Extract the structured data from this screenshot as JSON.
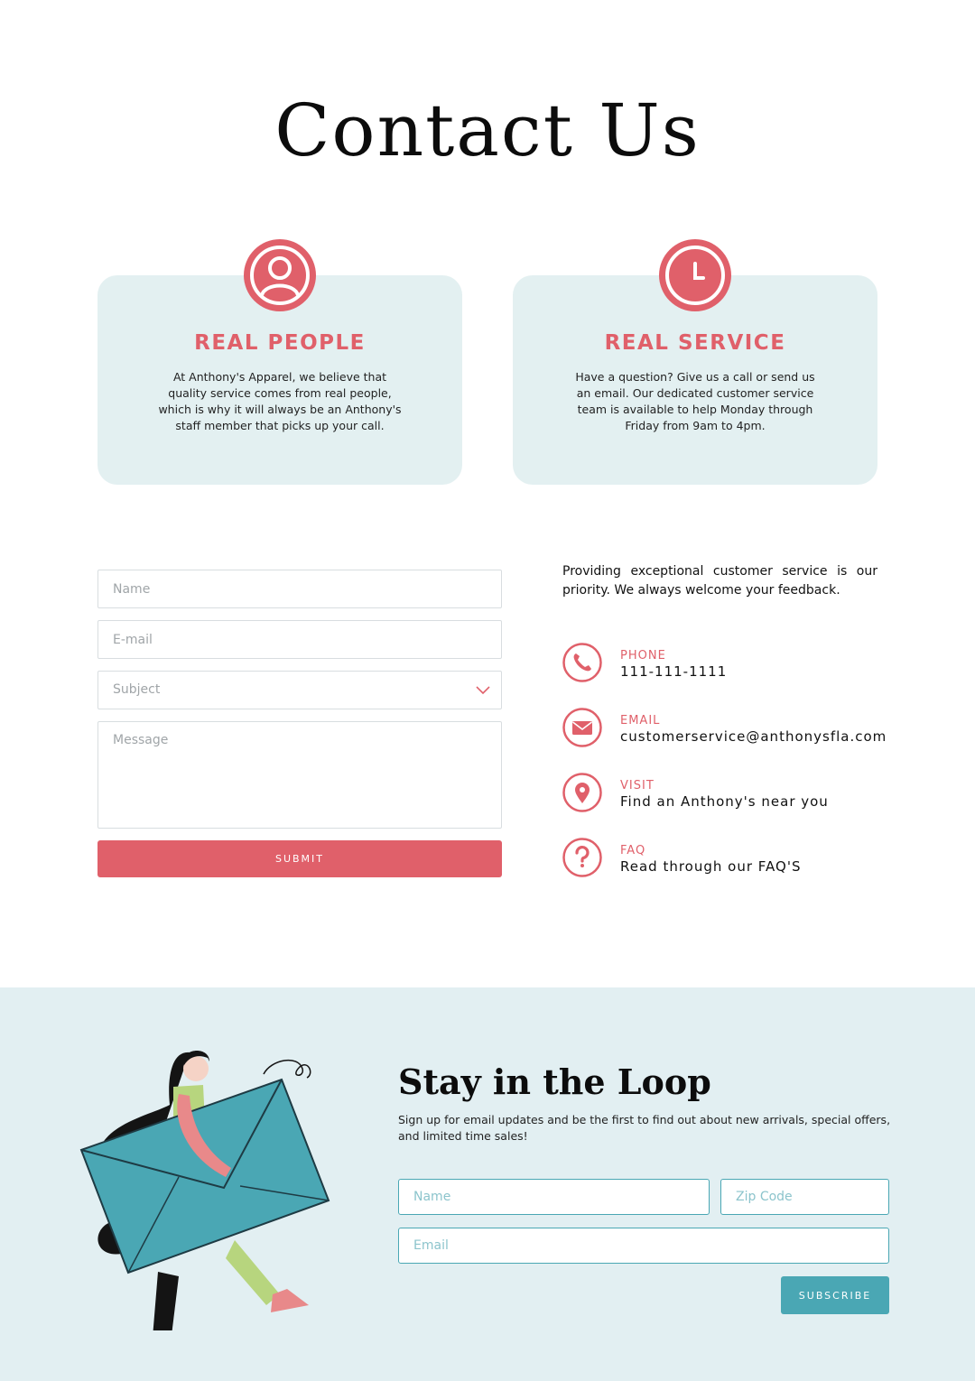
{
  "page_title": "Contact Us",
  "cards": [
    {
      "title": "REAL PEOPLE",
      "icon": "person-icon",
      "text": "At Anthony's Apparel, we believe that quality service comes from real people, which is why it will always be an Anthony's staff member that picks up your call."
    },
    {
      "title": "REAL SERVICE",
      "icon": "clock-icon",
      "text": "Have a question? Give us a call or send us an email. Our dedicated customer service team is available to help Monday through Friday from 9am to 4pm."
    }
  ],
  "form": {
    "name_placeholder": "Name",
    "email_placeholder": "E-mail",
    "subject_placeholder": "Subject",
    "message_placeholder": "Message",
    "submit_label": "SUBMIT"
  },
  "contact": {
    "intro": "Providing exceptional customer service is our priority. We always welcome your feedback.",
    "items": [
      {
        "icon": "phone-icon",
        "label": "PHONE",
        "value": "111-111-1111"
      },
      {
        "icon": "mail-icon",
        "label": "EMAIL",
        "value": "customerservice@anthonysfla.com"
      },
      {
        "icon": "location-pin-icon",
        "label": "VISIT",
        "value": "Find an Anthony's near you"
      },
      {
        "icon": "question-icon",
        "label": "FAQ",
        "value": "Read through our FAQ'S"
      }
    ]
  },
  "newsletter": {
    "title": "Stay in the Loop",
    "text": "Sign up for email updates and be the first to find out about new arrivals, special offers, and limited time sales!",
    "name_placeholder": "Name",
    "zip_placeholder": "Zip Code",
    "email_placeholder": "Email",
    "subscribe_label": "SUBSCRIBE"
  },
  "colors": {
    "accent": "#e0606a",
    "teal": "#4aa7b4",
    "card_bg": "#e3f0f1",
    "section_bg": "#e2eff2"
  }
}
